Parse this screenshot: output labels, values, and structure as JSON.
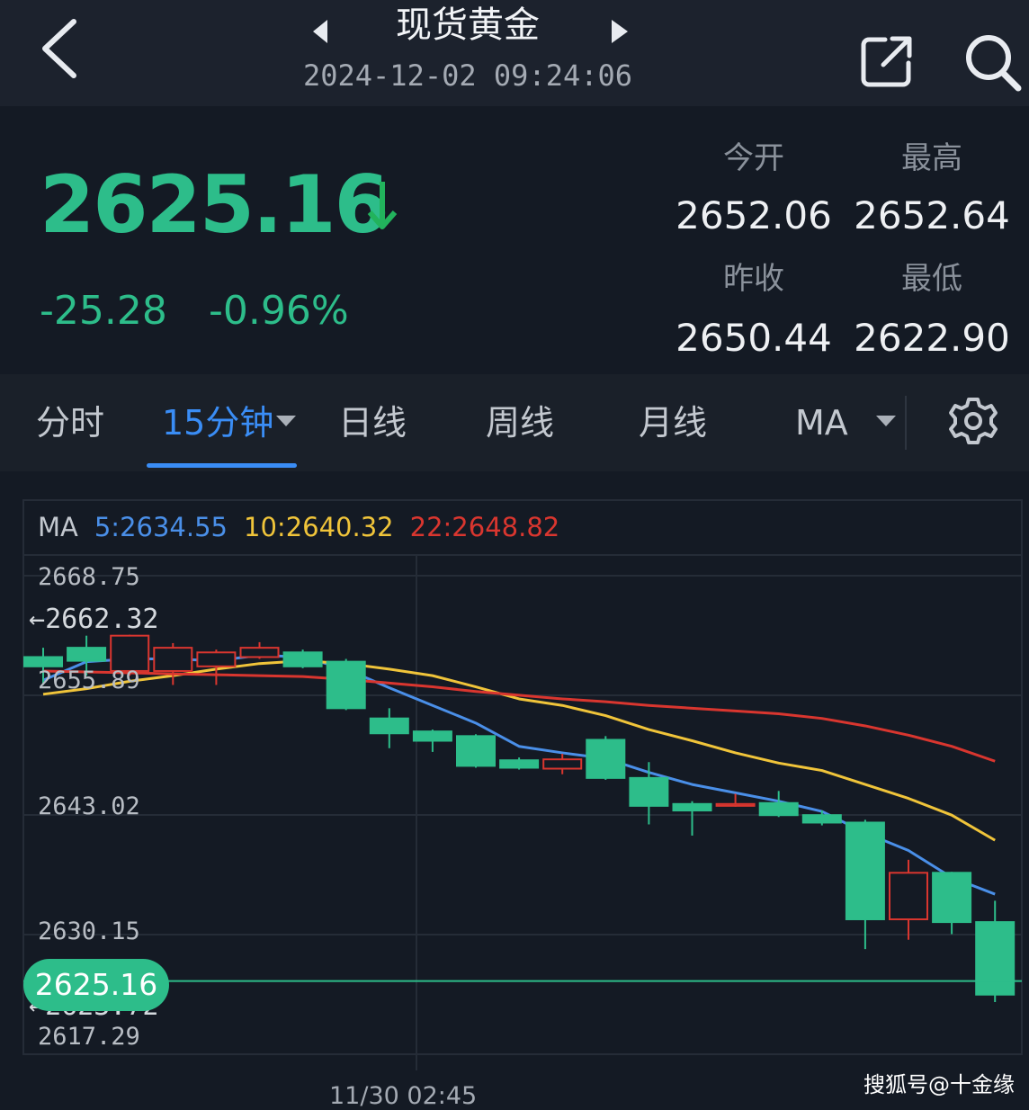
{
  "header": {
    "title": "现货黄金",
    "datetime": "2024-12-02 09:24:06"
  },
  "quote": {
    "price": "2625.16",
    "change": "-25.28",
    "change_pct": "-0.96%",
    "direction": "down",
    "stats": [
      {
        "label": "今开",
        "value": "2652.06"
      },
      {
        "label": "最高",
        "value": "2652.64"
      },
      {
        "label": "昨收",
        "value": "2650.44"
      },
      {
        "label": "最低",
        "value": "2622.90"
      }
    ]
  },
  "tabs": [
    {
      "label": "分时",
      "active": false
    },
    {
      "label": "15分钟",
      "active": true
    },
    {
      "label": "日线",
      "active": false
    },
    {
      "label": "周线",
      "active": false
    },
    {
      "label": "月线",
      "active": false
    },
    {
      "label": "MA",
      "active": false
    }
  ],
  "ma_legend": {
    "prefix": "MA",
    "items": [
      {
        "label": "5:2634.55",
        "color": "#4a8fe8"
      },
      {
        "label": "10:2640.32",
        "color": "#f0c43a"
      },
      {
        "label": "22:2648.82",
        "color": "#d9362f"
      }
    ]
  },
  "chart_data": {
    "type": "candlestick",
    "y_ticks": [
      "2668.75",
      "2655.89",
      "2643.02",
      "2630.15",
      "2617.29"
    ],
    "high_marker": "2662.32",
    "low_marker": "2623.72",
    "last_price": "2625.16",
    "x_label": "11/30 02:45",
    "ylim": [
      2617.29,
      2668.75
    ],
    "candles": [
      {
        "o": 2660.0,
        "c": 2659.0,
        "h": 2661.0,
        "l": 2657.0
      },
      {
        "o": 2661.0,
        "c": 2659.6,
        "h": 2662.3,
        "l": 2658.0
      },
      {
        "o": 2658.5,
        "c": 2662.3,
        "h": 2662.4,
        "l": 2658.0
      },
      {
        "o": 2658.5,
        "c": 2661.0,
        "h": 2661.5,
        "l": 2657.0
      },
      {
        "o": 2659.0,
        "c": 2660.5,
        "h": 2660.8,
        "l": 2657.0
      },
      {
        "o": 2660.0,
        "c": 2661.0,
        "h": 2661.6,
        "l": 2659.8
      },
      {
        "o": 2660.5,
        "c": 2659.0,
        "h": 2660.8,
        "l": 2658.8
      },
      {
        "o": 2659.5,
        "c": 2654.5,
        "h": 2659.8,
        "l": 2654.3
      },
      {
        "o": 2653.4,
        "c": 2651.8,
        "h": 2654.5,
        "l": 2650.2
      },
      {
        "o": 2652.0,
        "c": 2651.0,
        "h": 2652.2,
        "l": 2649.8
      },
      {
        "o": 2651.5,
        "c": 2648.3,
        "h": 2651.7,
        "l": 2648.1
      },
      {
        "o": 2648.9,
        "c": 2648.1,
        "h": 2649.2,
        "l": 2647.9
      },
      {
        "o": 2648.0,
        "c": 2649.0,
        "h": 2649.6,
        "l": 2647.4
      },
      {
        "o": 2651.1,
        "c": 2647.0,
        "h": 2651.5,
        "l": 2646.8
      },
      {
        "o": 2647.0,
        "c": 2644.0,
        "h": 2648.7,
        "l": 2642.0
      },
      {
        "o": 2644.2,
        "c": 2643.5,
        "h": 2644.5,
        "l": 2640.8
      },
      {
        "o": 2644.0,
        "c": 2644.2,
        "h": 2645.3,
        "l": 2643.9
      },
      {
        "o": 2644.3,
        "c": 2643.0,
        "h": 2645.6,
        "l": 2642.8
      },
      {
        "o": 2643.0,
        "c": 2642.2,
        "h": 2643.5,
        "l": 2641.9
      },
      {
        "o": 2642.2,
        "c": 2631.8,
        "h": 2642.5,
        "l": 2628.6
      },
      {
        "o": 2631.8,
        "c": 2636.8,
        "h": 2638.2,
        "l": 2629.6
      },
      {
        "o": 2636.8,
        "c": 2631.5,
        "h": 2636.9,
        "l": 2630.2
      },
      {
        "o": 2631.5,
        "c": 2623.7,
        "h": 2633.8,
        "l": 2622.9
      }
    ],
    "series": [
      {
        "name": "MA5",
        "color": "#4a8fe8",
        "values": [
          2657.5,
          2659.5,
          2659.8,
          2659.8,
          2659.6,
          2660.2,
          2660.0,
          2658.7,
          2656.7,
          2654.8,
          2652.9,
          2650.4,
          2649.7,
          2649.1,
          2647.6,
          2646.3,
          2645.4,
          2644.5,
          2643.4,
          2641.1,
          2639.2,
          2636.3,
          2634.5
        ]
      },
      {
        "name": "MA10",
        "color": "#f0c43a",
        "values": [
          2656.0,
          2656.6,
          2657.4,
          2658.0,
          2658.7,
          2659.3,
          2659.6,
          2659.3,
          2658.7,
          2658.0,
          2656.8,
          2655.5,
          2654.8,
          2653.7,
          2652.2,
          2651.0,
          2649.7,
          2648.6,
          2647.8,
          2646.3,
          2644.8,
          2643.0,
          2640.3
        ]
      },
      {
        "name": "MA22",
        "color": "#d9362f",
        "values": [
          2658.5,
          2658.4,
          2658.3,
          2658.2,
          2658.1,
          2658.0,
          2657.9,
          2657.6,
          2657.2,
          2656.8,
          2656.3,
          2655.9,
          2655.5,
          2655.2,
          2654.8,
          2654.5,
          2654.2,
          2653.9,
          2653.4,
          2652.6,
          2651.6,
          2650.4,
          2648.8
        ]
      }
    ]
  },
  "watermark": "搜狐号@十金缘"
}
